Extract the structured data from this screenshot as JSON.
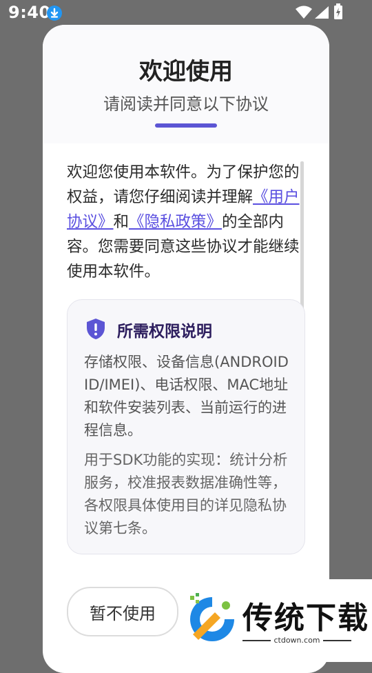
{
  "status_bar": {
    "time": "9:40"
  },
  "dialog": {
    "title": "欢迎使用",
    "subtitle": "请阅读并同意以下协议",
    "intro": {
      "part1": "欢迎您使用本软件。为了保护您的权益，请您仔细阅读并理解",
      "user_agreement_link": "《用户协议》",
      "and": "和",
      "privacy_policy_link": "《隐私政策》",
      "part2": "的全部内容。您需要同意这些协议才能继续使用本软件。"
    },
    "permissions": {
      "title": "所需权限说明",
      "description": "存储权限、设备信息(ANDROID ID/IMEI)、电话权限、MAC地址和软件安装列表、当前运行的进程信息。",
      "usage": "用于SDK功能的实现：统计分析服务，校准报表数据准确性等，各权限具体使用目的详见隐私协议第七条。"
    },
    "decline_button": "暂不使用",
    "accent_color": "#5c55d4"
  },
  "watermark": {
    "text": "传统下载",
    "url": "ctdown.com"
  }
}
